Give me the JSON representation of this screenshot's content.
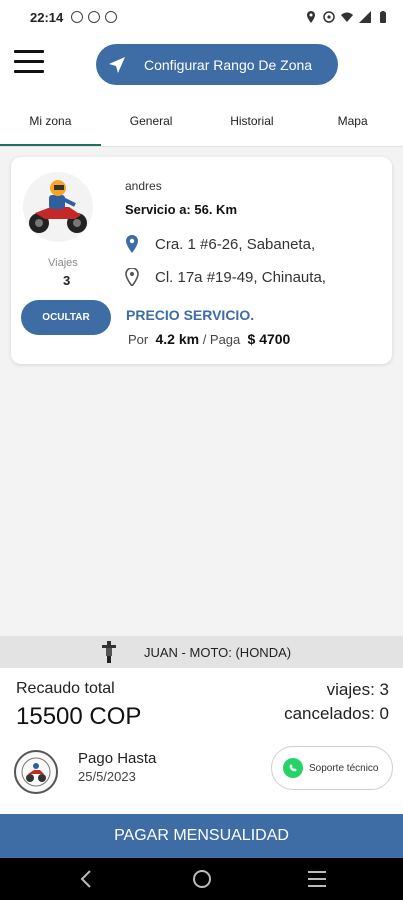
{
  "status_bar": {
    "time": "22:14"
  },
  "header": {
    "menu_icon": "hamburger-menu-icon",
    "zone_button_label": "Configurar Rango De Zona",
    "zone_button_icon": "navigation-arrow-icon"
  },
  "tabs": [
    {
      "label": "Mi zona",
      "active": true
    },
    {
      "label": "General",
      "active": false
    },
    {
      "label": "Historial",
      "active": false
    },
    {
      "label": "Mapa",
      "active": false
    }
  ],
  "service_card": {
    "driver_name": "andres",
    "viajes_label": "Viajes",
    "viajes_value": "3",
    "hide_button": "OCULTAR",
    "servicio": "Servicio a: 56. Km",
    "address_from": "Cra. 1 #6-26, Sabaneta,",
    "address_to": "Cl. 17a #19-49, Chinauta,",
    "precio_label": "PRECIO SERVICIO.",
    "por_label": "Por",
    "distance": "4.2 km",
    "paga_label": "/  Paga",
    "price": "$ 4700"
  },
  "vehicle": {
    "text": "JUAN - MOTO: (HONDA)"
  },
  "summary": {
    "recaudo_label": "Recaudo total",
    "recaudo_value": "15500 COP",
    "viajes_text": "viajes:  3",
    "cancelados_text": "cancelados:  0",
    "pago_label": "Pago Hasta",
    "pago_date": "25/5/2023",
    "soporte_label": "Soporte técnico"
  },
  "pay_button": "PAGAR MENSUALIDAD",
  "colors": {
    "primary": "#3e6ca5",
    "tab_indicator": "#1f6d63",
    "whatsapp": "#25d366"
  }
}
